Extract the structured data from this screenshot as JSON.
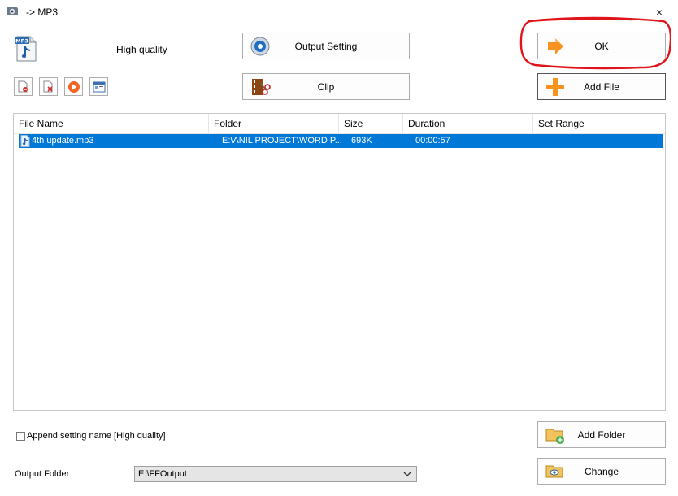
{
  "window": {
    "title": "-> MP3",
    "close_glyph": "×"
  },
  "profile": {
    "quality_label": "High quality",
    "format_icon_text": "MP3"
  },
  "buttons": {
    "output_setting": "Output Setting",
    "clip": "Clip",
    "ok": "OK",
    "add_file": "Add File",
    "add_folder": "Add Folder",
    "change": "Change"
  },
  "toolbar": {
    "tools": [
      "remove-icon",
      "clear-icon",
      "play-icon",
      "info-icon"
    ]
  },
  "file_list": {
    "columns": [
      "File Name",
      "Folder",
      "Size",
      "Duration",
      "Set Range"
    ],
    "rows": [
      {
        "file_name": "4th update.mp3",
        "folder": "E:\\ANIL PROJECT\\WORD P...",
        "size": "693K",
        "duration": "00:00:57",
        "set_range": ""
      }
    ]
  },
  "options": {
    "append_setting_label": "Append setting name [High quality]",
    "append_checked": false
  },
  "output": {
    "folder_label": "Output Folder",
    "folder_value": "E:\\FFOutput"
  },
  "colors": {
    "selection": "#0078d7",
    "highlight_circle": "#e0141b",
    "accent_orange": "#f7931e"
  }
}
